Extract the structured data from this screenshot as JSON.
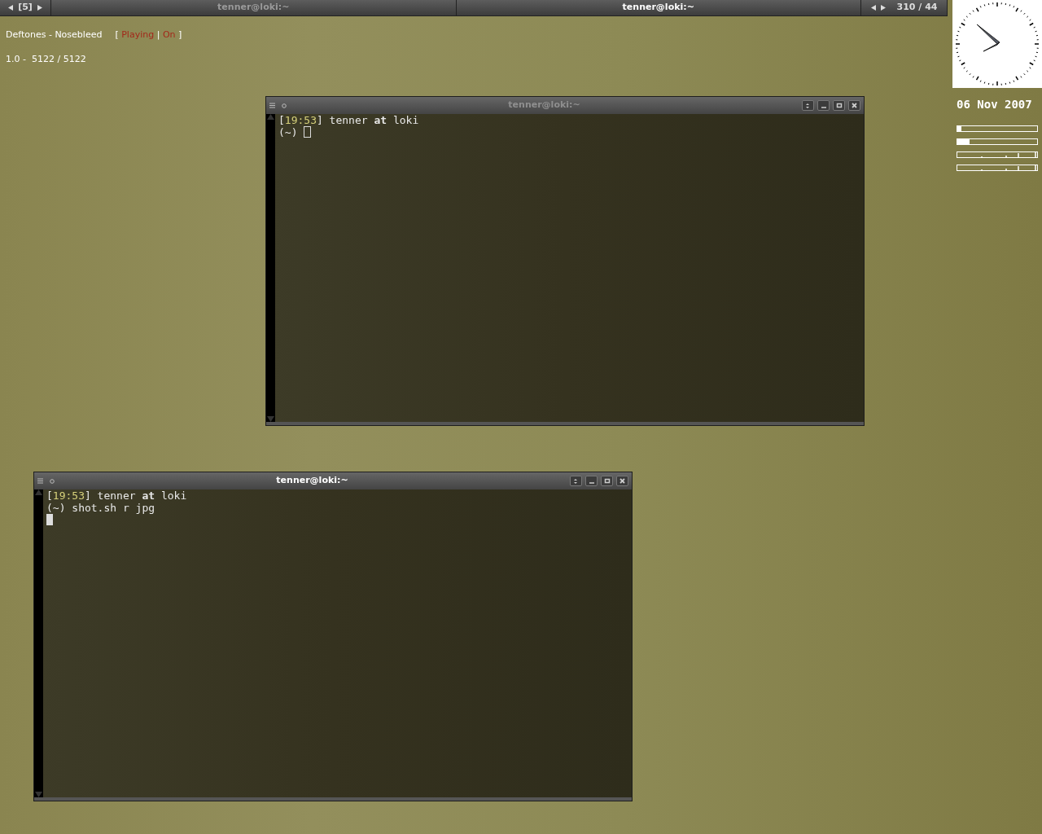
{
  "top_bar": {
    "workspace": "[5]",
    "tasks": [
      {
        "title": "tenner@loki:~",
        "selected": false
      },
      {
        "title": "tenner@loki:~",
        "selected": true
      }
    ],
    "pager": "310 / 44"
  },
  "now_playing": {
    "track": "Deftones - Nosebleed",
    "status_parts": [
      {
        "text": "[",
        "kind": "plain"
      },
      {
        "text": "Playing",
        "kind": "accent"
      },
      {
        "text": "|",
        "kind": "plain"
      },
      {
        "text": "On",
        "kind": "accent"
      },
      {
        "text": "]",
        "kind": "plain"
      }
    ],
    "position": "1.0 -  5122 / 5122"
  },
  "desktop_widget": {
    "date": "06 Nov 2007",
    "meters": [
      {
        "kind": "bar",
        "level": 0.05
      },
      {
        "kind": "bar",
        "level": 0.15
      },
      {
        "kind": "graph"
      },
      {
        "kind": "graph"
      }
    ]
  },
  "windows": [
    {
      "title": "tenner@loki:~",
      "focused": false,
      "lines": [
        [
          {
            "text": "[",
            "kind": "plain"
          },
          {
            "text": "19:53",
            "kind": "time"
          },
          {
            "text": "] tenner ",
            "kind": "plain"
          },
          {
            "text": "at",
            "kind": "bold"
          },
          {
            "text": " loki",
            "kind": "plain"
          }
        ],
        [
          {
            "text": "(~) ",
            "kind": "plain"
          }
        ]
      ]
    },
    {
      "title": "tenner@loki:~",
      "focused": true,
      "lines": [
        [
          {
            "text": "[",
            "kind": "plain"
          },
          {
            "text": "19:53",
            "kind": "time"
          },
          {
            "text": "] tenner ",
            "kind": "plain"
          },
          {
            "text": "at",
            "kind": "bold"
          },
          {
            "text": " loki",
            "kind": "plain"
          }
        ],
        [
          {
            "text": "(~) shot.sh r jpg",
            "kind": "plain"
          }
        ]
      ]
    }
  ]
}
